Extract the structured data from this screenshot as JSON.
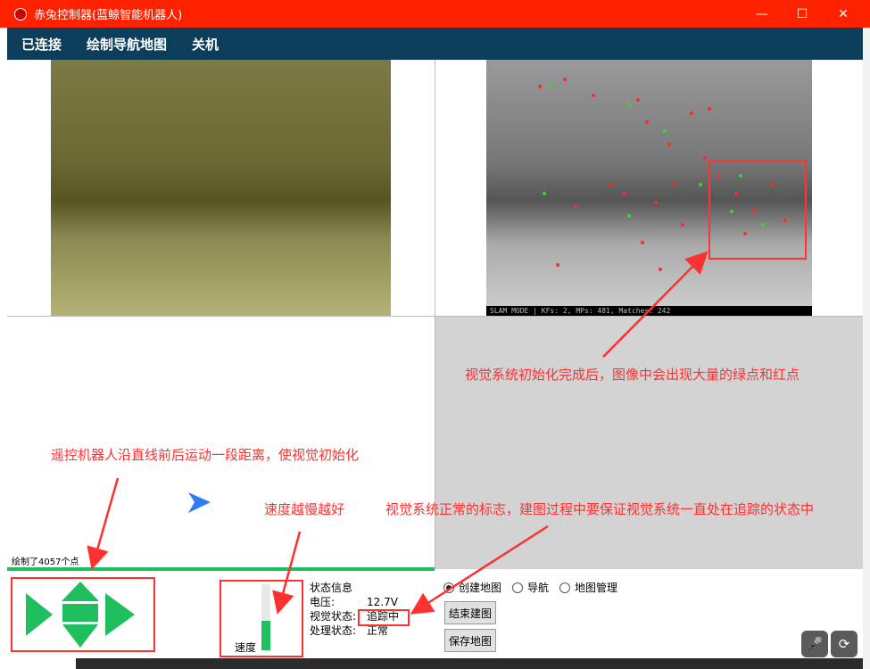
{
  "window": {
    "title": "赤兔控制器(蓝鲸智能机器人)",
    "minimize_icon": "minimize-icon",
    "maximize_icon": "maximize-icon",
    "close_icon": "close-icon"
  },
  "menu": {
    "items": [
      "已连接",
      "绘制导航地图",
      "关机"
    ]
  },
  "camera": {
    "slam_status": "SLAM MODE | KFs: 2, MPs: 481, Matches: 242"
  },
  "map": {
    "points_drawn": "绘制了4057个点"
  },
  "controls": {
    "speed_label": "速度",
    "speed_level": 0.45
  },
  "status": {
    "heading": "状态信息",
    "rows": [
      {
        "key": "电压:",
        "value": "12.7V"
      },
      {
        "key": "视觉状态:",
        "value": "追踪中"
      },
      {
        "key": "处理状态:",
        "value": "正常"
      }
    ]
  },
  "modes": {
    "options": [
      "创建地图",
      "导航",
      "地图管理"
    ],
    "selected": "创建地图"
  },
  "buttons": {
    "end_map": "结束建图",
    "save_map": "保存地图"
  },
  "annotations": {
    "init_points": "视觉系统初始化完成后，图像中会出现大量的绿点和红点",
    "drive_robot": "遥控机器人沿直线前后运动一段距离，使视觉初始化",
    "speed_slow": "速度越慢越好",
    "tracking_note": "视觉系统正常的标志，建图过程中要保证视觉系统一直处在追踪的状态中"
  },
  "colors": {
    "titlebar": "#ff2200",
    "menubar": "#0c3d5b",
    "accent_green": "#1fbf5f",
    "annotation_red": "#ff3030",
    "nav_arrow": "#2e7cf6"
  }
}
